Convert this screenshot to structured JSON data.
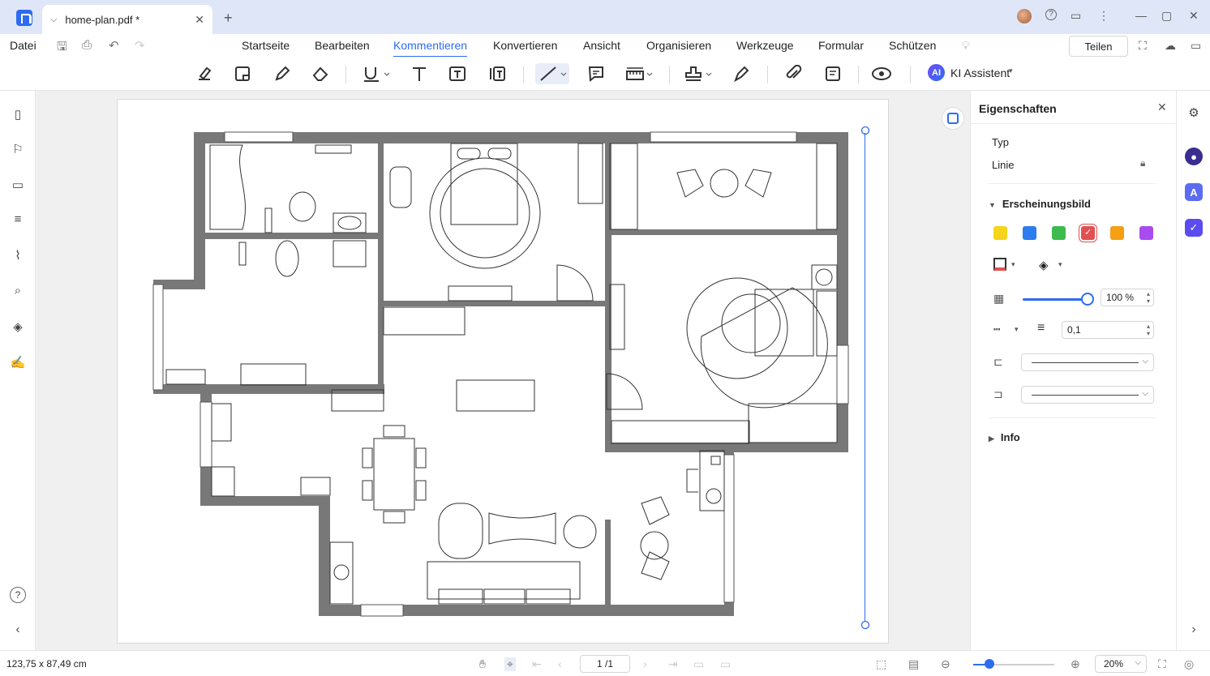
{
  "tab": {
    "title": "home-plan.pdf *",
    "close": "✕",
    "new": "+"
  },
  "window": {
    "help": "?",
    "feedback": "▭",
    "more": "⋮",
    "minimize": "—",
    "maximize": "▢",
    "close": "✕"
  },
  "menu": {
    "datei": "Datei",
    "items": [
      "Startseite",
      "Bearbeiten",
      "Kommentieren",
      "Konvertieren",
      "Ansicht",
      "Organisieren",
      "Werkzeuge",
      "Formular",
      "Schützen"
    ],
    "active": "Kommentieren",
    "share": "Teilen"
  },
  "toolbar": {
    "ai_badge": "AI",
    "ai_label": "KI Assistent",
    "tools": [
      "highlight-icon",
      "sticky-note-icon",
      "pencil-icon",
      "eraser-icon",
      "underline-icon",
      "text-icon",
      "textbox-icon",
      "callout-icon",
      "line-icon",
      "comment-icon",
      "measure-icon",
      "stamp-icon",
      "signature-icon",
      "attachment-icon",
      "markup-list-icon",
      "eye-icon"
    ]
  },
  "leftbar": [
    "pages-icon",
    "bookmark-icon",
    "comment-icon",
    "layers-list-icon",
    "attachment-icon",
    "search-icon",
    "layers-icon",
    "signature-icon"
  ],
  "properties": {
    "title": "Eigenschaften",
    "typ_label": "Typ",
    "typ_value": "Linie",
    "appearance": "Erscheinungsbild",
    "info": "Info",
    "colors": [
      "#f5d419",
      "#2d7cf0",
      "#3dbb4e",
      "#e15050",
      "#f59f13",
      "#a84cf0"
    ],
    "selected_color": "#e15050",
    "opacity": 1.0,
    "opacity_text": "100 %",
    "line_width": "0,1"
  },
  "status": {
    "dimensions": "123,75 x 87,49 cm",
    "page": "1 /1",
    "zoom": "20%",
    "zoom_level": 0.2
  },
  "colors": {
    "accent": "#2d6cf0",
    "titlebar": "#dfe6f7",
    "wall": "#777777"
  }
}
